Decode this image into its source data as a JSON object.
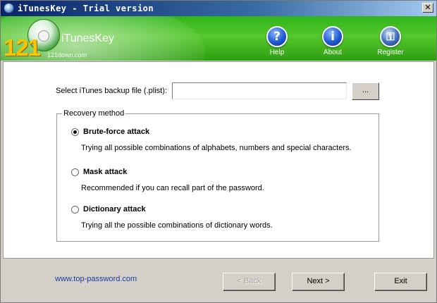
{
  "window": {
    "title": "iTunesKey - Trial version",
    "close_label": "✕"
  },
  "banner": {
    "logo_number": "121",
    "app_name": "iTunesKey",
    "site": "121down.com",
    "buttons": [
      {
        "label": "Help",
        "icon": "help-icon",
        "glyph": "?"
      },
      {
        "label": "About",
        "icon": "info-icon",
        "glyph": "i"
      },
      {
        "label": "Register",
        "icon": "key-icon",
        "glyph": "⚿"
      }
    ]
  },
  "file": {
    "label": "Select iTunes backup file (.plist):",
    "value": "",
    "placeholder": "",
    "browse_label": "..."
  },
  "recovery": {
    "legend": "Recovery method",
    "options": [
      {
        "title": "Brute-force attack",
        "desc": "Trying all possible combinations of alphabets, numbers and special characters.",
        "checked": true
      },
      {
        "title": "Mask attack",
        "desc": "Recommended if you can recall part of the password.",
        "checked": false
      },
      {
        "title": "Dictionary attack",
        "desc": "Trying all the possible combinations of dictionary words.",
        "checked": false
      }
    ]
  },
  "footer": {
    "link": "www.top-password.com",
    "back_label": "< Back",
    "next_label": "Next >",
    "exit_label": "Exit"
  }
}
